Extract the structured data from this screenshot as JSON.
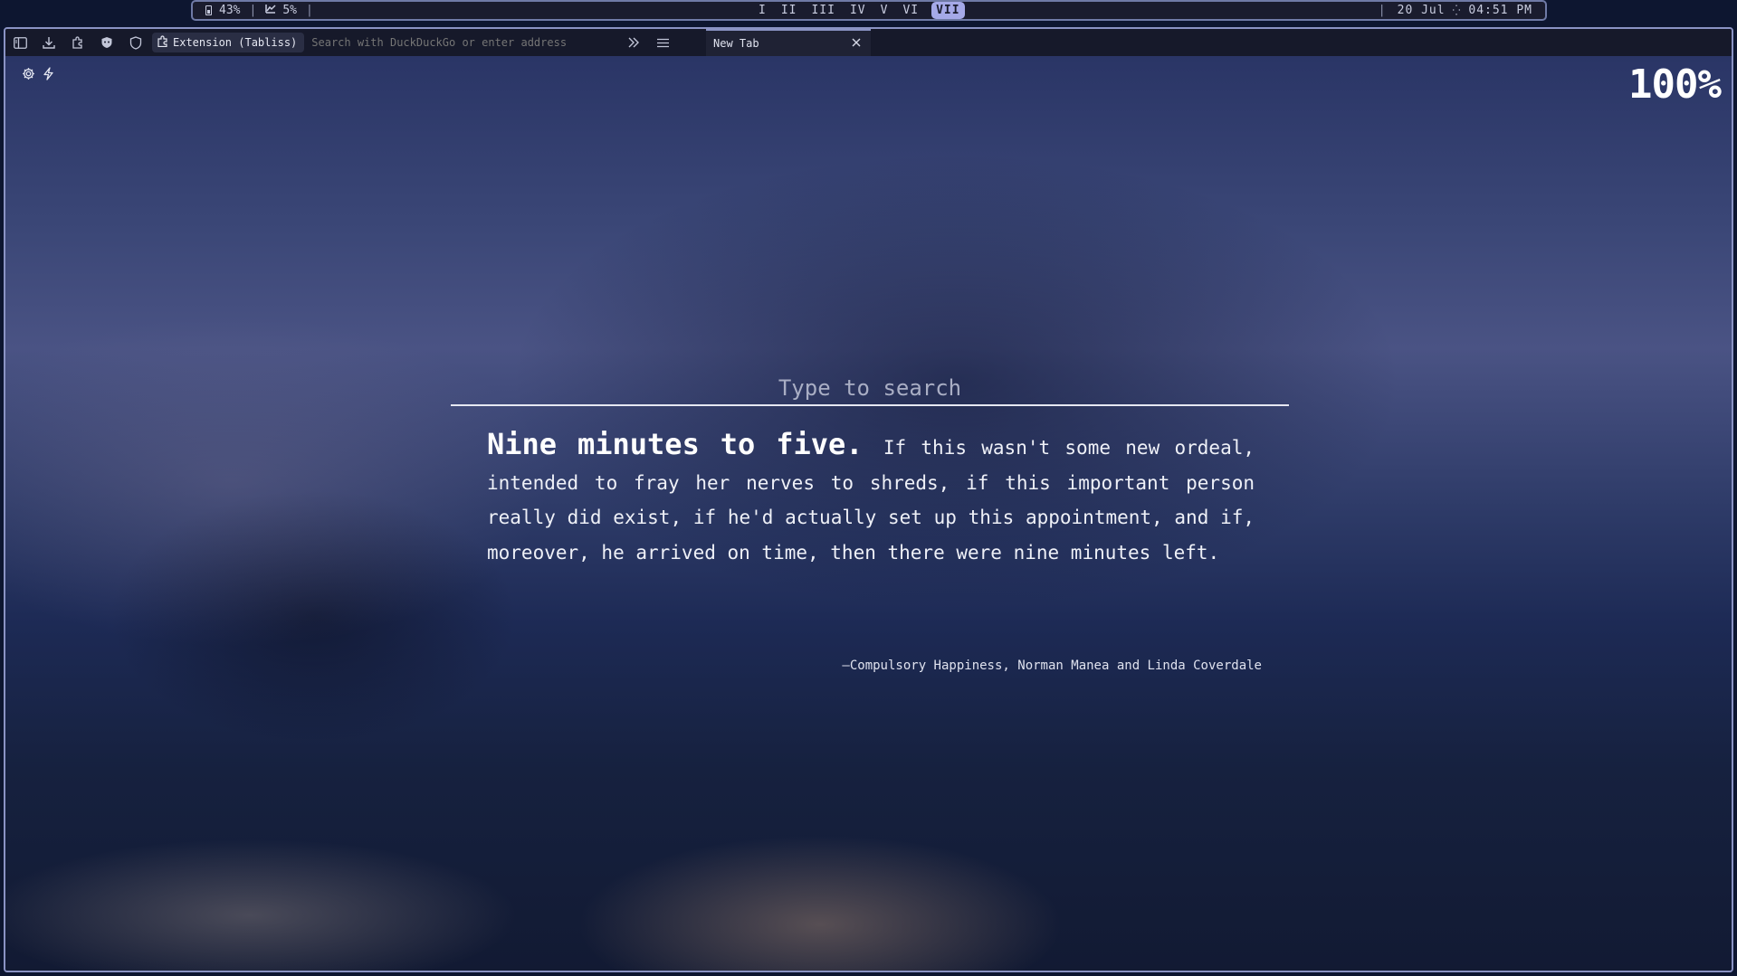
{
  "statusbar": {
    "battery": "43%",
    "cpu": "5%",
    "workspaces": [
      "I",
      "II",
      "III",
      "IV",
      "V",
      "VI",
      "VII"
    ],
    "active_workspace": "VII",
    "date": "20 Jul",
    "time": "04:51 PM"
  },
  "toolbar": {
    "icons": [
      "sidebar-icon",
      "download-icon",
      "extension-icon",
      "privacy-badger-icon",
      "shield-icon"
    ],
    "extension_label": "Extension (Tabliss)",
    "address_placeholder": "Search with DuckDuckGo or enter address",
    "overflow_icon": "chevrons-right-icon",
    "menu_icon": "hamburger-icon"
  },
  "tab": {
    "title": "New Tab",
    "close_icon": "close-icon"
  },
  "page": {
    "widget_icons": [
      "gear-icon",
      "bolt-icon"
    ],
    "zoom": "100%",
    "search_placeholder": "Type to search",
    "quote_lead": "Nine minutes to five.",
    "quote_body": "If this wasn't some new ordeal, intended to fray her nerves to shreds, if this important person really did exist, if he'd actually set up this appointment, and if, moreover, he arrived on time, then there were nine minutes left.",
    "attribution": "—Compulsory Happiness, Norman Manea and Linda Coverdale"
  },
  "colors": {
    "bar_background": "#1a1c2e",
    "bar_border": "#6f7aa6",
    "active_workspace": "#a5a9e8",
    "window_border": "#8a93c4",
    "text": "#eef0f7"
  }
}
